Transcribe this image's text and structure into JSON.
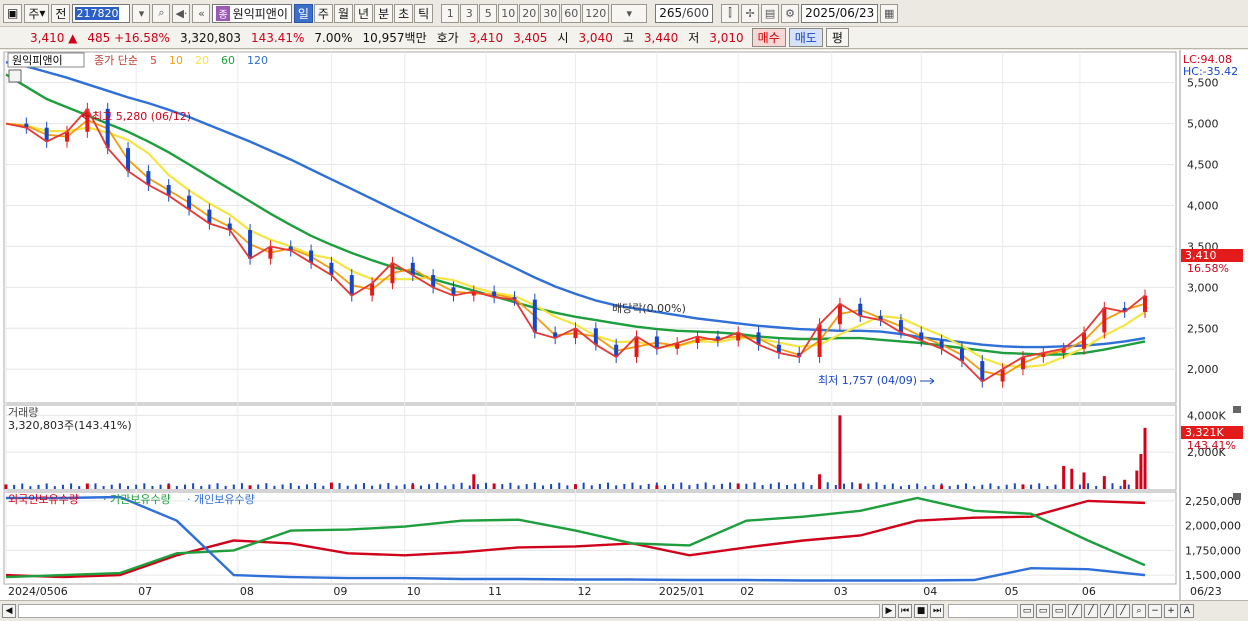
{
  "toolbar": {
    "period_label": "주",
    "prev_label": "전",
    "code": "217820",
    "stock_badge": "종",
    "stock_name": "원익피앤이",
    "period_tabs": [
      "일",
      "주",
      "월",
      "년",
      "분",
      "초",
      "틱"
    ],
    "active_tab": "일",
    "minute_options": [
      "1",
      "3",
      "5",
      "10",
      "20",
      "30",
      "60",
      "120"
    ],
    "count_value": "265",
    "count_total": "/600",
    "date_value": "2025/06/23"
  },
  "quote": {
    "price": "3,410",
    "change": "485",
    "change_pct": "+16.58%",
    "volume": "3,320,803",
    "volume_ratio": "143.41%",
    "turnover": "7.00%",
    "amount": "10,957백만",
    "bid_label": "호가",
    "ask_price": "3,410",
    "bid_price": "3,405",
    "open_label": "시",
    "open": "3,040",
    "high_label": "고",
    "high": "3,440",
    "low_label": "저",
    "low": "3,010",
    "buy_label": "매수",
    "sell_label": "매도",
    "eval_label": "평"
  },
  "price_panel": {
    "title": "원익피앤이",
    "legend_prefix": "종가 단순",
    "legend": [
      {
        "label": "5",
        "color": "#e53935"
      },
      {
        "label": "10",
        "color": "#f39c12"
      },
      {
        "label": "20",
        "color": "#f4e542"
      },
      {
        "label": "60",
        "color": "#1e9e3c"
      },
      {
        "label": "120",
        "color": "#2f6fd8"
      }
    ],
    "lc": "LC:94.08",
    "hc": "HC:-35.42",
    "high_note": "최고 5,280 (06/12)",
    "low_note": "최저 1,757 (04/09)",
    "dividend_note": "배당락(0.00%)",
    "last_price": "3,410",
    "last_pct": "16.58%"
  },
  "volume_panel": {
    "title": "거래량",
    "info": "3,320,803주(143.41%)",
    "last_value": "3,321K",
    "last_pct": "143.41%"
  },
  "holding_panel": {
    "legend": [
      {
        "label": "외국인보유수량",
        "color": "#d0021b"
      },
      {
        "label": "기관보유수량",
        "color": "#1e9e3c"
      },
      {
        "label": "개인보유수량",
        "color": "#2f6fd8"
      }
    ]
  },
  "chart_data": {
    "type": "line",
    "price_axis": {
      "ticks": [
        "5,500",
        "5,000",
        "4,500",
        "4,000",
        "3,500",
        "3,000",
        "2,500",
        "2,000"
      ],
      "ylim": [
        1600,
        5850
      ]
    },
    "volume_axis": {
      "ticks": [
        "4,000K",
        "2,000K"
      ],
      "ylim": [
        0,
        4400
      ]
    },
    "holding_axis": {
      "ticks": [
        "2,250,000",
        "2,000,000",
        "1,750,000",
        "1,500,000"
      ],
      "ylim": [
        1420000,
        2320000
      ]
    },
    "x_labels": [
      "2024/0506",
      "07",
      "08",
      "09",
      "10",
      "11",
      "12",
      "2025/01",
      "02",
      "03",
      "04",
      "05",
      "06",
      "06/23"
    ],
    "price": {
      "x": [
        0,
        5,
        10,
        15,
        20,
        25,
        30,
        35,
        40,
        45,
        50,
        55,
        60,
        65,
        70,
        75,
        80,
        85,
        90,
        95,
        100,
        105,
        110,
        115,
        120,
        125,
        130,
        135,
        140,
        145,
        150,
        155,
        160,
        165,
        170,
        175,
        180,
        185,
        190,
        195,
        200,
        205,
        210,
        215,
        220,
        225,
        230,
        235,
        240,
        245,
        250,
        255,
        260,
        265,
        270,
        275,
        280
      ],
      "close": [
        5000,
        4950,
        4780,
        4900,
        5180,
        4700,
        4420,
        4250,
        4120,
        3950,
        3780,
        3700,
        3350,
        3500,
        3450,
        3300,
        3150,
        2900,
        3050,
        3300,
        3150,
        3000,
        2900,
        2950,
        2880,
        2850,
        2450,
        2380,
        2500,
        2300,
        2150,
        2400,
        2250,
        2320,
        2400,
        2350,
        2450,
        2300,
        2200,
        2150,
        2550,
        2800,
        2650,
        2600,
        2450,
        2350,
        2250,
        2100,
        1850,
        2000,
        2150,
        2200,
        2250,
        2450,
        2750,
        2700,
        2900
      ]
    },
    "ma": {
      "ma60": [
        5600,
        5450,
        5300,
        5200,
        5100,
        5000,
        4900,
        4780,
        4650,
        4500,
        4350,
        4200,
        4050,
        3900,
        3760,
        3630,
        3520,
        3420,
        3330,
        3250,
        3180,
        3100,
        3030,
        2960,
        2890,
        2820,
        2750,
        2690,
        2640,
        2600,
        2560,
        2520,
        2490,
        2470,
        2460,
        2450,
        2430,
        2400,
        2380,
        2370,
        2370,
        2380,
        2380,
        2360,
        2340,
        2320,
        2290,
        2260,
        2230,
        2200,
        2190,
        2180,
        2180,
        2200,
        2240,
        2290,
        2340
      ],
      "ma120": [
        5750,
        5700,
        5630,
        5560,
        5480,
        5400,
        5320,
        5250,
        5170,
        5080,
        4980,
        4880,
        4780,
        4670,
        4560,
        4440,
        4320,
        4200,
        4080,
        3960,
        3840,
        3720,
        3600,
        3480,
        3360,
        3240,
        3120,
        3010,
        2920,
        2840,
        2780,
        2740,
        2700,
        2660,
        2620,
        2590,
        2560,
        2530,
        2510,
        2490,
        2480,
        2470,
        2470,
        2460,
        2430,
        2390,
        2360,
        2330,
        2300,
        2280,
        2270,
        2270,
        2280,
        2290,
        2310,
        2340,
        2380
      ]
    },
    "volume": {
      "x": [
        0,
        20,
        40,
        60,
        80,
        100,
        115,
        120,
        140,
        160,
        180,
        200,
        205,
        210,
        230,
        250,
        260,
        262,
        265,
        270,
        275,
        278,
        279,
        280
      ],
      "values": [
        250,
        300,
        250,
        200,
        350,
        250,
        800,
        300,
        250,
        200,
        300,
        800,
        4000,
        300,
        200,
        250,
        1250,
        1100,
        900,
        700,
        500,
        1000,
        1900,
        3321
      ]
    },
    "holding_series": [
      {
        "name": "외국인보유수량",
        "values": [
          1500000,
          1480000,
          1500000,
          1700000,
          1850000,
          1820000,
          1720000,
          1700000,
          1730000,
          1780000,
          1790000,
          1820000,
          1700000,
          1780000,
          1850000,
          1900000,
          2050000,
          2080000,
          2090000,
          2250000,
          2230000
        ]
      },
      {
        "name": "기관보유수량",
        "values": [
          1480000,
          1500000,
          1520000,
          1720000,
          1750000,
          1950000,
          1960000,
          1990000,
          2050000,
          2060000,
          1950000,
          1820000,
          1800000,
          2050000,
          2090000,
          2150000,
          2280000,
          2150000,
          2120000,
          1850000,
          1600000
        ]
      },
      {
        "name": "개인보유수량",
        "values": [
          2280000,
          2280000,
          2290000,
          2050000,
          1500000,
          1480000,
          1470000,
          1470000,
          1460000,
          1460000,
          1455000,
          1455000,
          1450000,
          1450000,
          1445000,
          1445000,
          1445000,
          1450000,
          1570000,
          1560000,
          1500000
        ]
      }
    ]
  }
}
